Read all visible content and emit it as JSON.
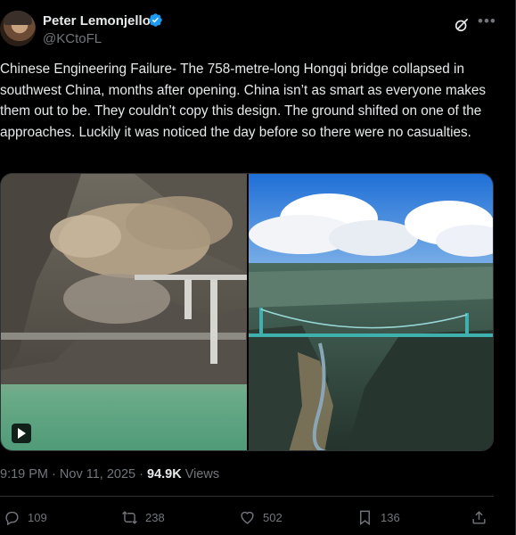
{
  "author": {
    "display_name": "Peter Lemonjello",
    "handle": "@KCtoFL"
  },
  "icons": {
    "verified": "verified-badge-icon",
    "grok": "grok-icon",
    "more": "more-icon",
    "play": "play-icon",
    "reply": "reply-icon",
    "repost": "repost-icon",
    "like": "like-icon",
    "bookmark": "bookmark-icon",
    "share": "share-icon"
  },
  "colors": {
    "background": "#000000",
    "text": "#e7e9ea",
    "muted": "#71767b",
    "verified": "#1d9bf0",
    "border": "#2f3336"
  },
  "tweet": {
    "text": "Chinese Engineering Failure- The 758-metre-long Hongqi bridge collapsed in southwest China, months after opening. China isn’t as smart as everyone makes them out to be. They couldn’t copy this design. The ground shifted on one of the approaches. Luckily it was noticed the day before so there were no casualties.",
    "time": "9:19 PM",
    "date": "Nov 11, 2025",
    "separator": "·",
    "views_count": "94.9K",
    "views_label": "Views"
  },
  "media": {
    "count": 2,
    "left_has_video": true
  },
  "actions": {
    "replies": "109",
    "reposts": "238",
    "likes": "502",
    "bookmarks": "136"
  }
}
